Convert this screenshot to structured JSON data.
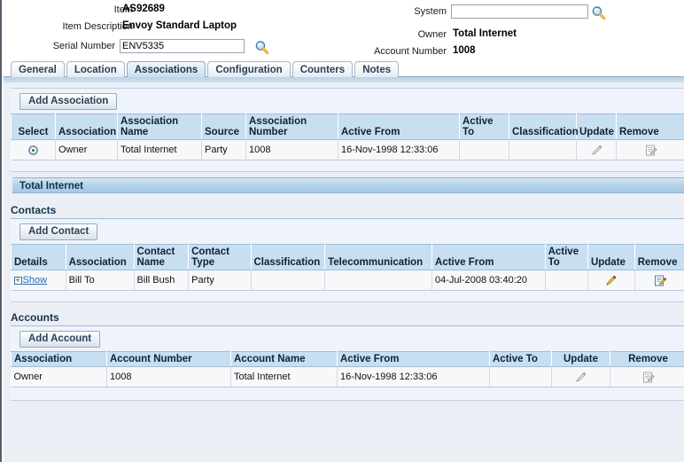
{
  "header": {
    "fields": [
      {
        "label": "Item",
        "value": "AS92689",
        "type": "text"
      },
      {
        "label": "Item Description",
        "value": "Envoy Standard Laptop",
        "type": "text"
      },
      {
        "label": "Serial Number",
        "value": "ENV5335",
        "type": "input",
        "placeholder": "",
        "icon": "search-icon"
      },
      {
        "label": "System",
        "value": "",
        "type": "input",
        "placeholder": "",
        "icon": "search-icon"
      },
      {
        "label": "Owner",
        "value": "Total Internet",
        "type": "text"
      },
      {
        "label": "Account Number",
        "value": "1008",
        "type": "text"
      }
    ],
    "item_label": "Item",
    "item_value": "AS92689",
    "item_desc_label": "Item Description",
    "item_desc_value": "Envoy Standard Laptop",
    "serial_label": "Serial Number",
    "serial_value": "ENV5335",
    "system_label": "System",
    "system_value": "",
    "owner_label": "Owner",
    "owner_value": "Total Internet",
    "account_label": "Account Number",
    "account_value": "1008"
  },
  "tabs": [
    {
      "label": "General",
      "selected": false
    },
    {
      "label": "Location",
      "selected": false
    },
    {
      "label": "Associations",
      "selected": true
    },
    {
      "label": "Configuration",
      "selected": false
    },
    {
      "label": "Counters",
      "selected": false
    },
    {
      "label": "Notes",
      "selected": false
    }
  ],
  "associations": {
    "add_button": "Add Association",
    "columns": [
      "Select",
      "Association",
      "Association Name",
      "Source",
      "Association Number",
      "Active From",
      "Active To",
      "Classification",
      "Update",
      "Remove"
    ],
    "rows": [
      {
        "select": "selected",
        "association": "Owner",
        "association_name": "Total Internet",
        "source": "Party",
        "association_number": "1008",
        "active_from": "16-Nov-1998 12:33:06",
        "active_to": "",
        "classification": "",
        "update_icon": "pencil-icon-disabled",
        "remove_icon": "remove-icon-disabled"
      }
    ]
  },
  "owner_section_title": "Total Internet",
  "contacts": {
    "title": "Contacts",
    "add_button": "Add Contact",
    "columns": [
      "Details",
      "Association",
      "Contact Name",
      "Contact Type",
      "Classification",
      "Telecommunication",
      "Active From",
      "Active To",
      "Update",
      "Remove"
    ],
    "rows": [
      {
        "details": "Show",
        "association": "Bill To",
        "contact_name": "Bill Bush",
        "contact_type": "Party",
        "classification": "",
        "telecommunication": "",
        "active_from": "04-Jul-2008 03:40:20",
        "active_to": "",
        "update_icon": "pencil-icon",
        "remove_icon": "remove-icon"
      }
    ]
  },
  "accounts": {
    "title": "Accounts",
    "add_button": "Add Account",
    "columns": [
      "Association",
      "Account Number",
      "Account Name",
      "Active From",
      "Active To",
      "Update",
      "Remove"
    ],
    "rows": [
      {
        "association": "Owner",
        "account_number": "1008",
        "account_name": "Total Internet",
        "active_from": "16-Nov-1998 12:33:06",
        "active_to": "",
        "update_icon": "pencil-icon-disabled",
        "remove_icon": "remove-icon-disabled"
      }
    ]
  },
  "colors": {
    "tab_selected": "#c5ddef",
    "table_header": "#c8dff1",
    "section_bar": "#a6c9e4",
    "panel_bg": "#eff3fb",
    "page_bg": "#eceef5",
    "link": "#1f6fb5"
  }
}
